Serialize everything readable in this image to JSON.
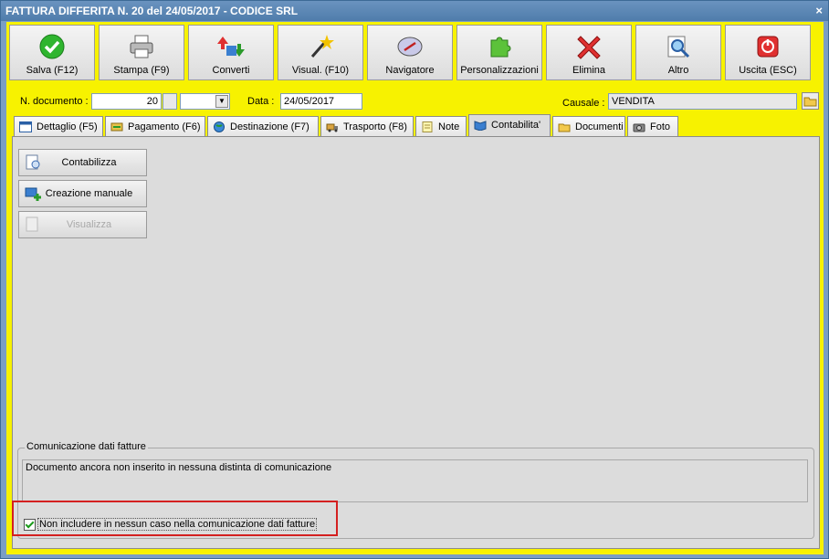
{
  "window": {
    "title": "FATTURA DIFFERITA N. 20 del 24/05/2017 - CODICE SRL",
    "close_label": "×"
  },
  "toolbar": {
    "buttons": [
      {
        "label": "Salva (F12)",
        "icon": "check-icon"
      },
      {
        "label": "Stampa (F9)",
        "icon": "printer-icon"
      },
      {
        "label": "Converti",
        "icon": "convert-icon"
      },
      {
        "label": "Visual. (F10)",
        "icon": "magic-wand-icon"
      },
      {
        "label": "Navigatore",
        "icon": "compass-icon"
      },
      {
        "label": "Personalizzazioni",
        "icon": "puzzle-icon"
      },
      {
        "label": "Elimina",
        "icon": "delete-x-icon"
      },
      {
        "label": "Altro",
        "icon": "search-doc-icon"
      },
      {
        "label": "Uscita (ESC)",
        "icon": "exit-icon"
      }
    ]
  },
  "header": {
    "doc_number_label": "N. documento :",
    "doc_number_value": "20",
    "series_value": "",
    "date_label": "Data :",
    "date_value": "24/05/2017",
    "causale_label": "Causale :",
    "causale_value": "VENDITA"
  },
  "tabs": [
    {
      "label": "Dettaglio (F5)"
    },
    {
      "label": "Pagamento (F6)"
    },
    {
      "label": "Destinazione (F7)"
    },
    {
      "label": "Trasporto (F8)"
    },
    {
      "label": "Note"
    },
    {
      "label": "Contabilita'"
    },
    {
      "label": "Documenti"
    },
    {
      "label": "Foto"
    }
  ],
  "actions": {
    "contabilizza": "Contabilizza",
    "creazione_manuale": "Creazione manuale",
    "visualizza": "Visualizza"
  },
  "comunicazione": {
    "group_title": "Comunicazione dati fatture",
    "status_text": "Documento ancora non inserito in nessuna distinta di comunicazione",
    "checkbox_label": "Non includere in nessun caso nella comunicazione dati fatture",
    "checkbox_checked": true
  },
  "colors": {
    "background": "#f7f200",
    "titlebar": "#4f7cab",
    "highlight": "#d42020"
  }
}
